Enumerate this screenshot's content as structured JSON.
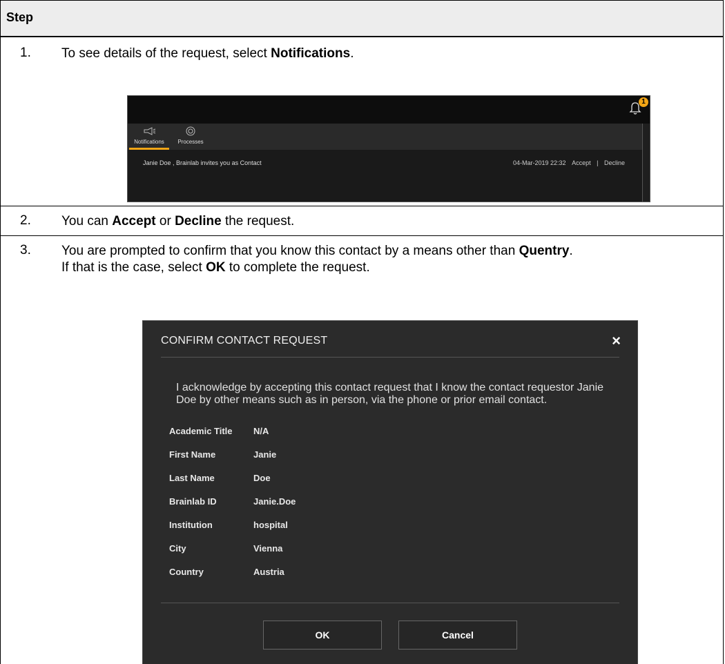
{
  "table": {
    "header": "Step",
    "steps": [
      {
        "num": "1.",
        "text_pre": "To see details of the request, select ",
        "text_bold": "Notifications",
        "text_post": "."
      },
      {
        "num": "2.",
        "text_a": "You can ",
        "text_b": "Accept",
        "text_c": " or ",
        "text_d": "Decline",
        "text_e": " the request."
      },
      {
        "num": "3.",
        "line1_pre": "You are prompted to confirm that you know this contact by a means other than ",
        "line1_bold": "Quentry",
        "line1_post": ".",
        "line2_pre": "If that is the case, select ",
        "line2_bold": "OK",
        "line2_post": " to complete the request."
      }
    ]
  },
  "notification_panel": {
    "badge_count": "1",
    "tabs": [
      "Notifications",
      "Processes"
    ],
    "active_tab": "Notifications",
    "message": "Janie Doe , Brainlab invites you as Contact",
    "datetime": "04-Mar-2019 22:32",
    "accept_label": "Accept",
    "separator": "|",
    "decline_label": "Decline",
    "accent_color": "#f2a516",
    "icons": {
      "notifications": "megaphone-icon",
      "processes": "target-icon",
      "bell": "bell-icon"
    }
  },
  "confirm_dialog": {
    "title": "CONFIRM CONTACT REQUEST",
    "close_symbol": "×",
    "acknowledgement": "I acknowledge by accepting this contact request that I know the contact requestor Janie Doe by other means such as in person, via the phone or prior email contact.",
    "fields": [
      {
        "label": "Academic Title",
        "value": "N/A"
      },
      {
        "label": "First Name",
        "value": "Janie"
      },
      {
        "label": "Last Name",
        "value": "Doe"
      },
      {
        "label": "Brainlab ID",
        "value": "Janie.Doe"
      },
      {
        "label": "Institution",
        "value": "hospital"
      },
      {
        "label": "City",
        "value": "Vienna"
      },
      {
        "label": "Country",
        "value": "Austria"
      }
    ],
    "ok_label": "OK",
    "cancel_label": "Cancel"
  }
}
